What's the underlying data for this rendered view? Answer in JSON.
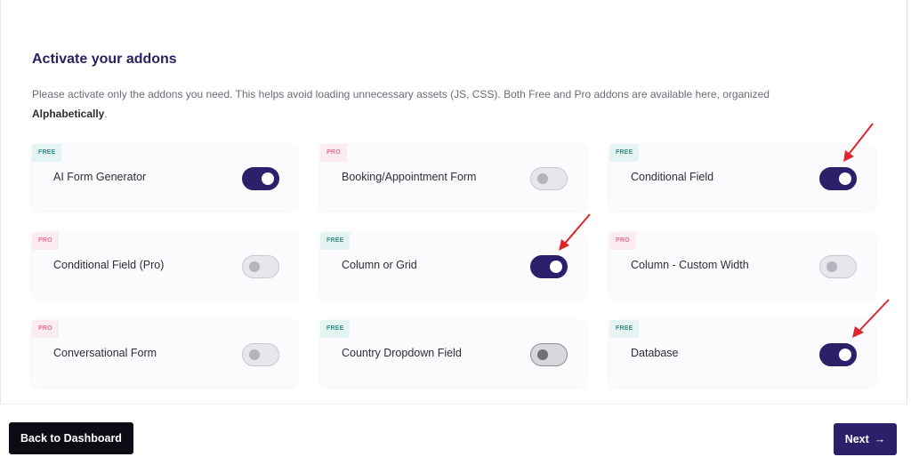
{
  "header": {
    "title": "Activate your addons",
    "description": "Please activate only the addons you need. This helps avoid loading unnecessary assets (JS, CSS). Both Free and Pro addons are available here, organized",
    "description_bold": "Alphabetically",
    "description_end": "."
  },
  "addons": [
    {
      "badge": "FREE",
      "tier": "free",
      "label": "AI Form Generator",
      "enabled": true
    },
    {
      "badge": "PRO",
      "tier": "pro",
      "label": "Booking/Appointment Form",
      "enabled": false
    },
    {
      "badge": "FREE",
      "tier": "free",
      "label": "Conditional Field",
      "enabled": true
    },
    {
      "badge": "PRO",
      "tier": "pro",
      "label": "Conditional Field (Pro)",
      "enabled": false
    },
    {
      "badge": "FREE",
      "tier": "free",
      "label": "Column or Grid",
      "enabled": true
    },
    {
      "badge": "PRO",
      "tier": "pro",
      "label": "Column - Custom Width",
      "enabled": false
    },
    {
      "badge": "PRO",
      "tier": "pro",
      "label": "Conversational Form",
      "enabled": false
    },
    {
      "badge": "FREE",
      "tier": "free",
      "label": "Country Dropdown Field",
      "enabled": false
    },
    {
      "badge": "FREE",
      "tier": "free",
      "label": "Database",
      "enabled": true
    }
  ],
  "footer": {
    "back_label": "Back to Dashboard",
    "next_label": "Next",
    "next_icon": "→"
  },
  "colors": {
    "accent": "#2e1f6b",
    "free_badge": "#3c8b85",
    "pro_badge": "#e2729a",
    "annotation_arrow": "#e0262a"
  }
}
